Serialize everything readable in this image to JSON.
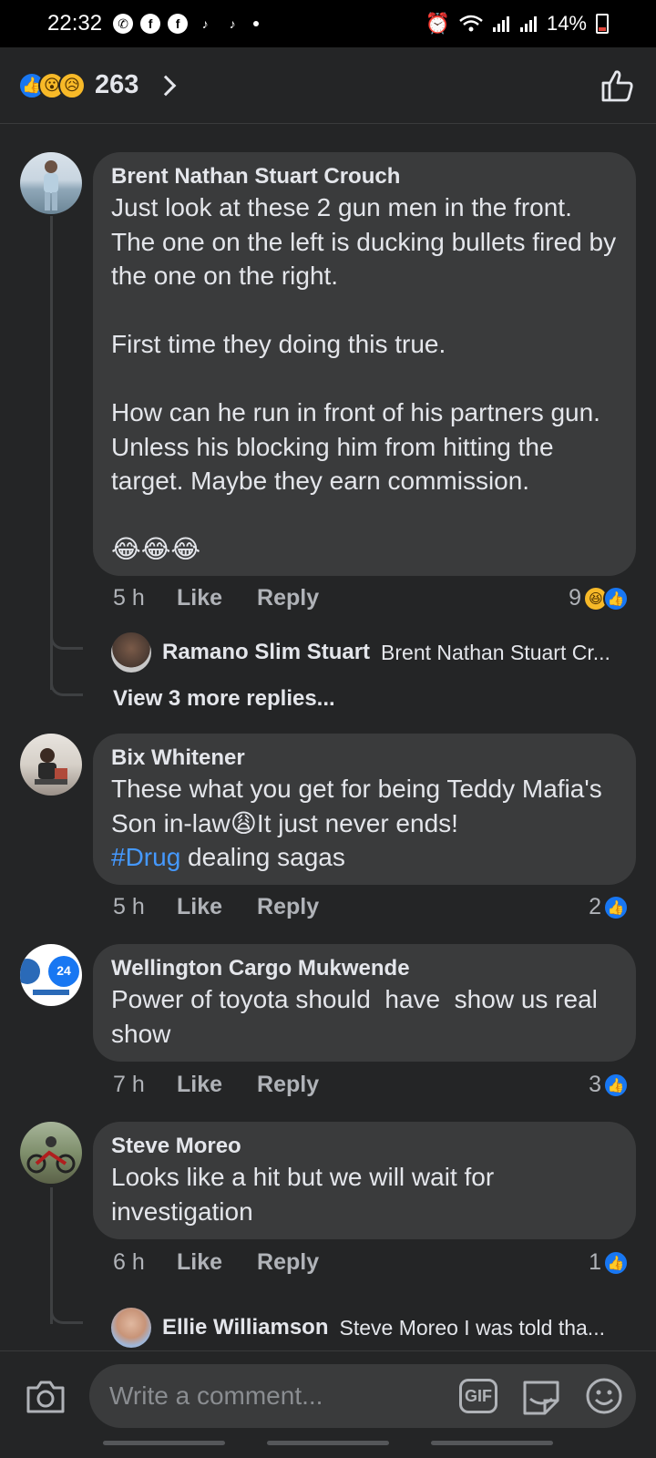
{
  "status_bar": {
    "time": "22:32",
    "battery": "14%",
    "left_icons": [
      "whatsapp-icon",
      "facebook-icon",
      "facebook-icon",
      "tiktok-icon",
      "tiktok-icon"
    ],
    "right_icons": [
      "alarm-icon",
      "wifi-icon",
      "signal-icon",
      "signal-icon",
      "battery-icon"
    ]
  },
  "top_bar": {
    "reactions": [
      "like",
      "wow",
      "sad"
    ],
    "reaction_count": "263"
  },
  "comments": [
    {
      "author": "Brent Nathan Stuart Crouch",
      "text": "Just look at these 2 gun men in the front. The one on the left is ducking bullets fired by the one on the right.\n\nFirst time they doing this true.\n\nHow can he run in front of his partners gun. Unless his blocking him from hitting the target. Maybe they earn commission.\n\n😂😂😂",
      "time": "5 h",
      "like_label": "Like",
      "reply_label": "Reply",
      "reaction_count": "9",
      "reply_preview": {
        "author": "Ramano Slim Stuart",
        "snippet": "Brent Nathan Stuart Cr..."
      },
      "view_more": "View 3 more replies..."
    },
    {
      "author": "Bix Whitener",
      "text_before": "These what you get for being Teddy Mafia's Son in-law😩It just never ends!\n",
      "hashtag": "#Drug",
      "text_after": " dealing sagas",
      "time": "5 h",
      "like_label": "Like",
      "reply_label": "Reply",
      "reaction_count": "2"
    },
    {
      "author": "Wellington Cargo Mukwende",
      "text": "Power of toyota should  have  show us real show",
      "time": "7 h",
      "like_label": "Like",
      "reply_label": "Reply",
      "reaction_count": "3"
    },
    {
      "author": "Steve Moreo",
      "text": "Looks like a hit but we will wait for investigation",
      "time": "6 h",
      "like_label": "Like",
      "reply_label": "Reply",
      "reaction_count": "1",
      "reply_preview": {
        "author": "Ellie Williamson",
        "snippet": "Steve Moreo I was told tha..."
      }
    }
  ],
  "composer": {
    "placeholder": "Write a comment...",
    "gif_label": "GIF"
  },
  "colors": {
    "background": "#242526",
    "bubble": "#3a3b3c",
    "like_blue": "#1877f2",
    "hashtag": "#4599ff"
  }
}
